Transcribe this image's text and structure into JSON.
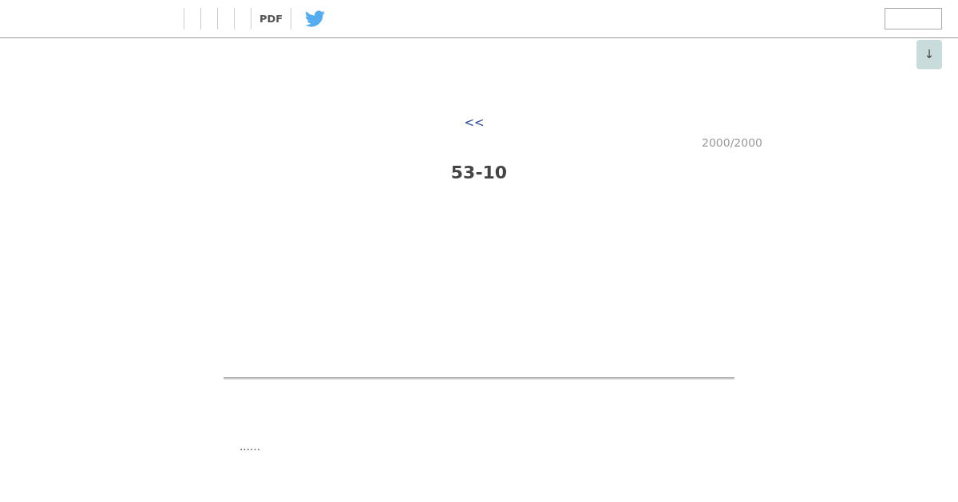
{
  "header": {
    "pdf_link": "PDF"
  },
  "scroll_button": {
    "label": "↓"
  },
  "page": {
    "back_link": "<<",
    "page_count": "2000/2000",
    "title": "53-10",
    "body": "……"
  }
}
